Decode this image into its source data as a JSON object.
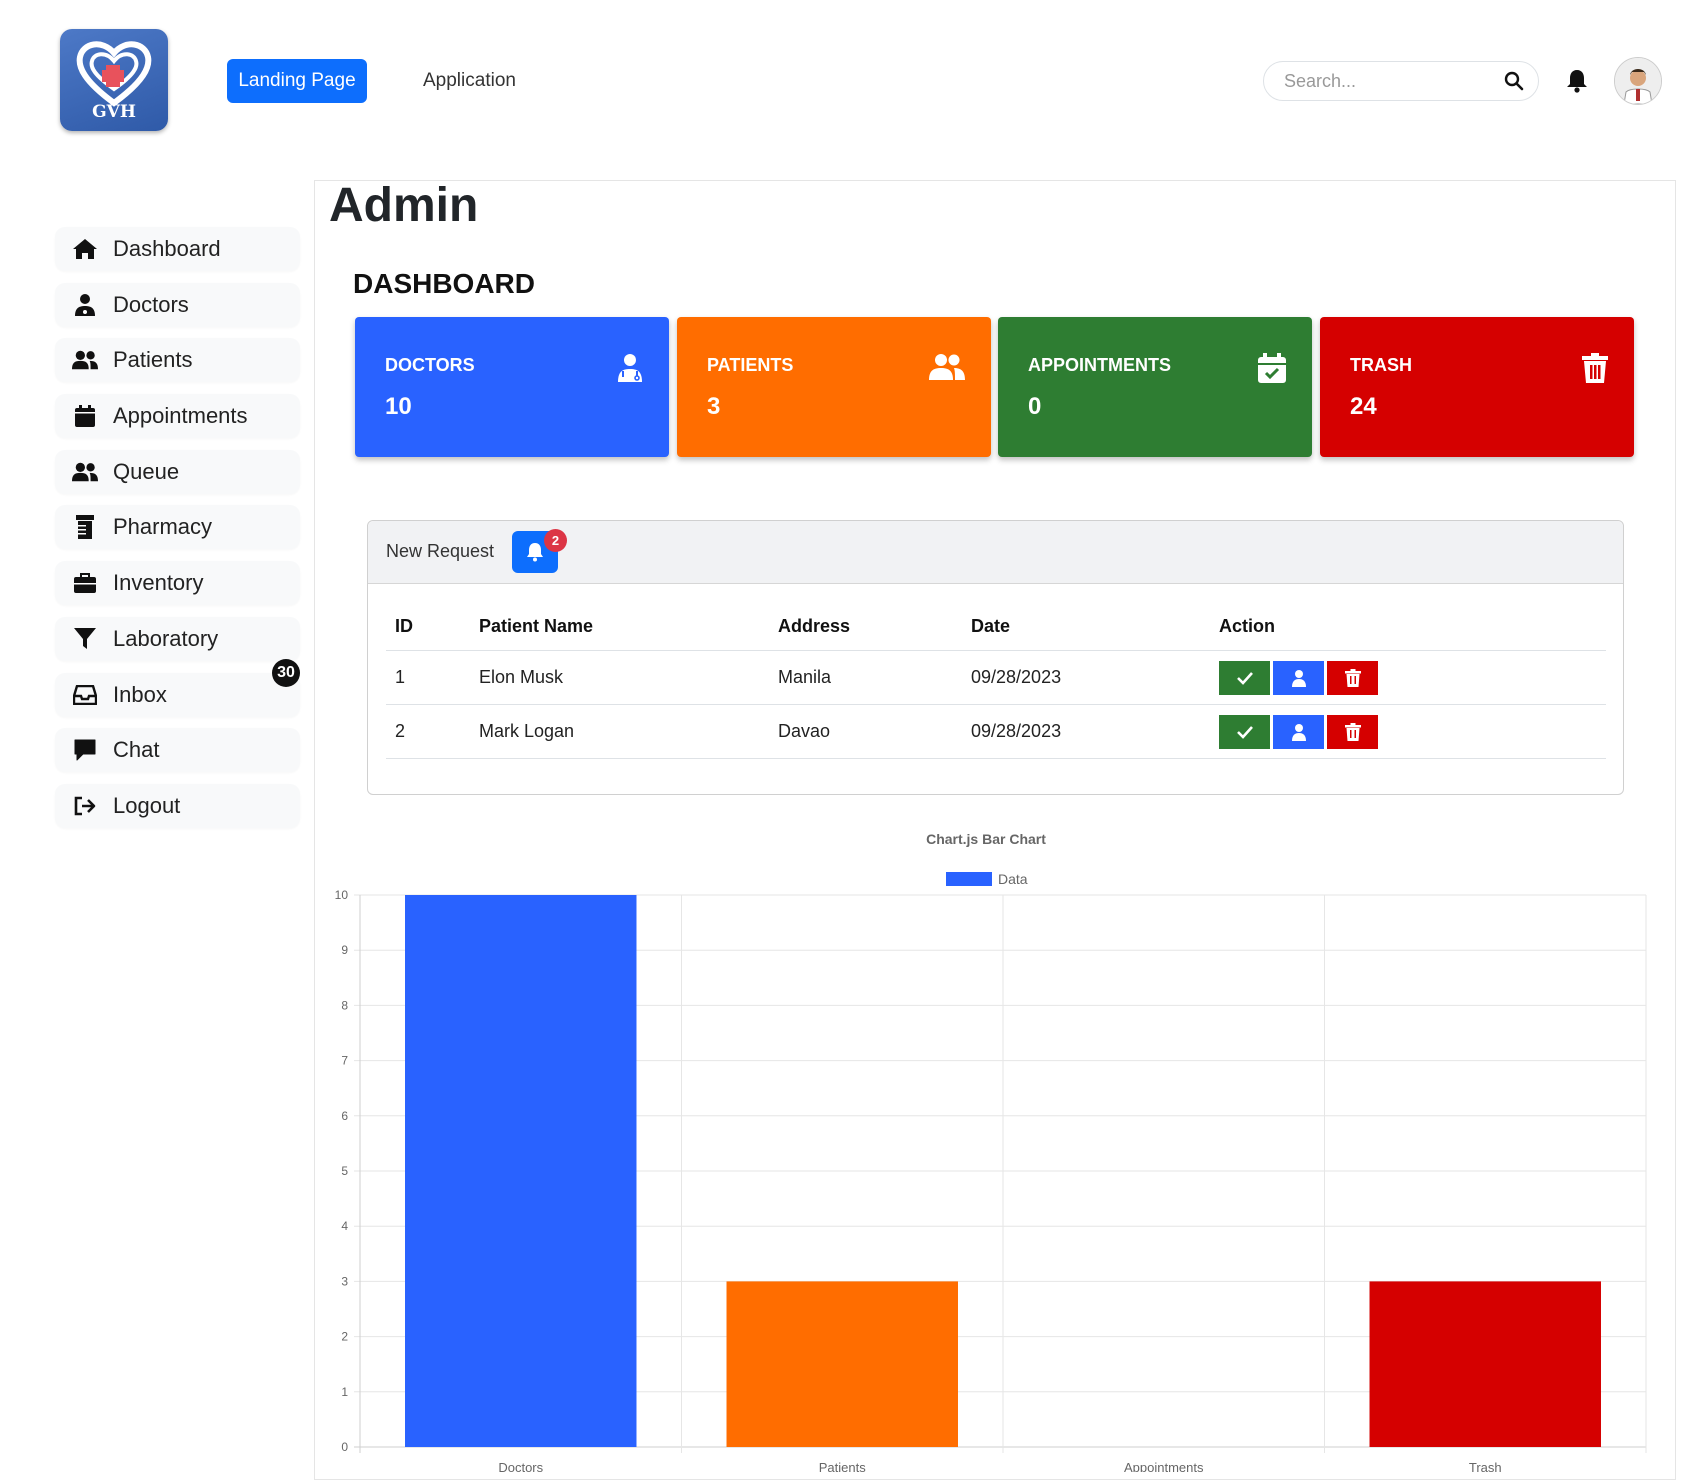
{
  "header": {
    "logo_text": "GVH",
    "nav": {
      "landing": "Landing Page",
      "application": "Application"
    },
    "search_placeholder": "Search..."
  },
  "sidebar": {
    "items": [
      {
        "label": "Dashboard",
        "icon": "home-icon"
      },
      {
        "label": "Doctors",
        "icon": "user-doctor-icon"
      },
      {
        "label": "Patients",
        "icon": "users-icon"
      },
      {
        "label": "Appointments",
        "icon": "calendar-icon"
      },
      {
        "label": "Queue",
        "icon": "users-icon"
      },
      {
        "label": "Pharmacy",
        "icon": "prescription-bottle-icon"
      },
      {
        "label": "Inventory",
        "icon": "briefcase-icon"
      },
      {
        "label": "Laboratory",
        "icon": "filter-icon"
      },
      {
        "label": "Inbox",
        "icon": "inbox-icon",
        "badge": "30"
      },
      {
        "label": "Chat",
        "icon": "chat-icon"
      },
      {
        "label": "Logout",
        "icon": "logout-icon"
      }
    ]
  },
  "main": {
    "title": "Admin",
    "subtitle": "DASHBOARD",
    "cards": [
      {
        "label": "DOCTORS",
        "value": "10",
        "color": "#2962ff",
        "icon": "user-doctor-icon"
      },
      {
        "label": "PATIENTS",
        "value": "3",
        "color": "#ff6d00",
        "icon": "users-icon"
      },
      {
        "label": "APPOINTMENTS",
        "value": "0",
        "color": "#2e7d32",
        "icon": "calendar-check-icon"
      },
      {
        "label": "TRASH",
        "value": "24",
        "color": "#d50000",
        "icon": "trash-icon"
      }
    ]
  },
  "requests": {
    "title": "New Request",
    "badge": "2",
    "columns": [
      "ID",
      "Patient Name",
      "Address",
      "Date",
      "Action"
    ],
    "rows": [
      {
        "id": "1",
        "name": "Elon Musk",
        "address": "Manila",
        "date": "09/28/2023"
      },
      {
        "id": "2",
        "name": "Mark Logan",
        "address": "Davao",
        "date": "09/28/2023"
      }
    ]
  },
  "chart_data": {
    "type": "bar",
    "title": "Chart.js Bar Chart",
    "legend": [
      "Data"
    ],
    "legend_position": "top",
    "categories": [
      "Doctors",
      "Patients",
      "Appointments",
      "Trash"
    ],
    "values": [
      10,
      3,
      0,
      3
    ],
    "colors": [
      "#2962ff",
      "#ff6d00",
      "#2e7d32",
      "#d50000"
    ],
    "ylim": [
      0,
      10
    ],
    "yticks": [
      "0",
      "1",
      "2",
      "3",
      "4",
      "5",
      "6",
      "7",
      "8",
      "9",
      "10"
    ],
    "grid": true
  }
}
